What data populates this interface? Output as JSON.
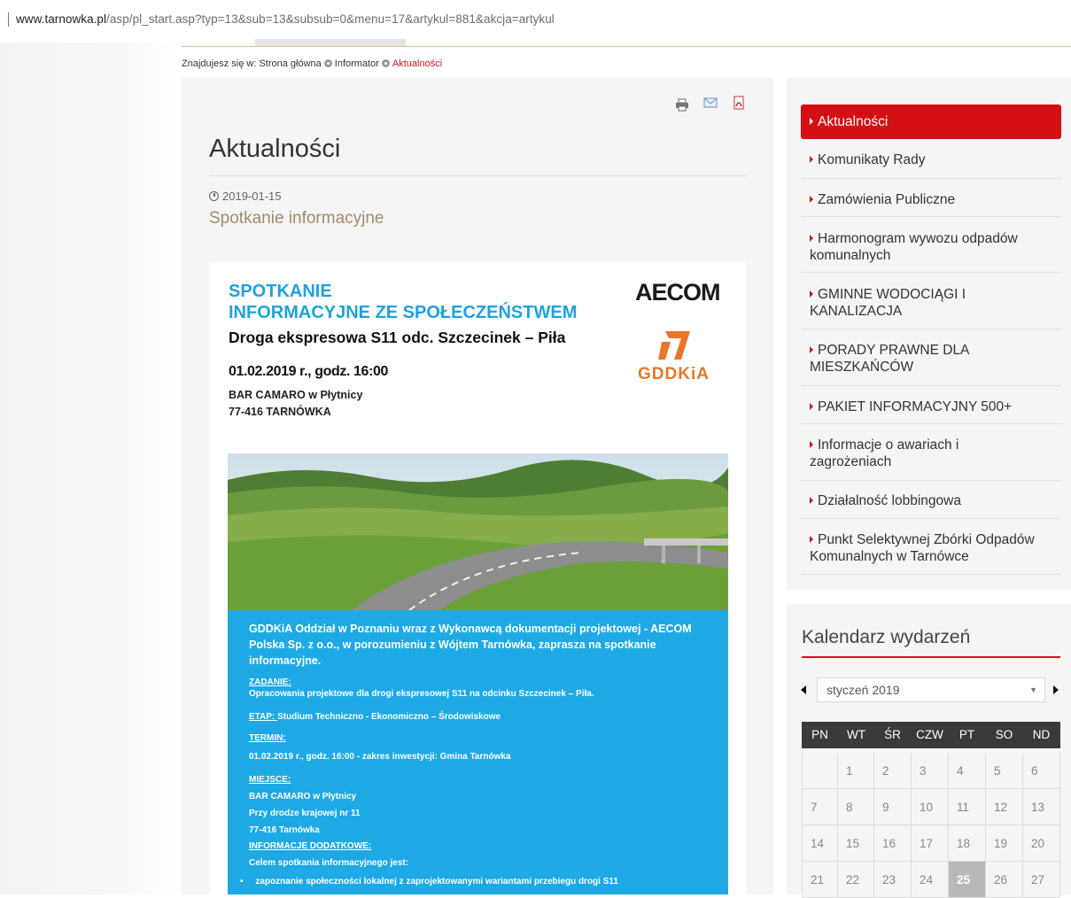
{
  "browser": {
    "url_host": "www.tarnowka.pl",
    "url_path": "/asp/pl_start.asp?typ=13&sub=13&subsub=0&menu=17&artykul=881&akcja=artykul"
  },
  "breadcrumb": {
    "prefix": "Znajdujesz się w:",
    "items": [
      "Strona główna",
      "Informator",
      "Aktualności"
    ]
  },
  "article": {
    "section_title": "Aktualności",
    "date": "2019-01-15",
    "title": "Spotkanie informacyjne",
    "tools": [
      "print-icon",
      "email-icon",
      "pdf-icon"
    ]
  },
  "poster": {
    "heading_line1": "SPOTKANIE",
    "heading_line2": "INFORMACYJNE ZE SPOŁECZEŃSTWEM",
    "road": "Droga ekspresowa S11 odc. Szczecinek – Piła",
    "datetime": "01.02.2019 r., godz. 16:00",
    "place": "BAR CAMARO w Płytnicy",
    "postal": "77-416 TARNÓWKA",
    "logo_aecom": "AECOM",
    "logo_gddkia": "GDDKiA",
    "intro": "GDDKiA Oddział w Poznaniu wraz z Wykonawcą dokumentacji projektowej - AECOM Polska Sp. z o.o., w porozumieniu z Wójtem Tarnówka, zaprasza na spotkanie informacyjne.",
    "zadanie_label": "ZADANIE:",
    "zadanie_text": "Opracowania projektowe dla drogi ekspresowej S11 na odcinku Szczecinek – Piła.",
    "etap_label": "ETAP:",
    "etap_text": "Studium Techniczno - Ekonomiczno – Środowiskowe",
    "termin_label": "TERMIN:",
    "termin_text": "01.02.2019 r., godz. 16:00 - zakres inwestycji: Gmina Tarnówka",
    "miejsce_label": "MIEJSCE:",
    "miejsce_line1": "BAR CAMARO w Płytnicy",
    "miejsce_line2": "Przy drodze krajowej nr 11",
    "miejsce_line3": "77-416 Tarnówka",
    "info_label": "INFORMACJE DODATKOWE:",
    "info_intro": "Celem spotkania informacyjnego jest:",
    "bullet1": "zapoznanie społeczności lokalnej z zaprojektowanymi wariantami przebiegu drogi S11"
  },
  "sidebar_menu": [
    {
      "label": "Aktualności",
      "active": true
    },
    {
      "label": "Komunikaty Rady"
    },
    {
      "label": "Zamówienia Publiczne"
    },
    {
      "label": "Harmonogram wywozu odpadów komunalnych"
    },
    {
      "label": "GMINNE WODOCIĄGI I KANALIZACJA"
    },
    {
      "label": "PORADY PRAWNE DLA MIESZKAŃCÓW"
    },
    {
      "label": "PAKIET INFORMACYJNY 500+"
    },
    {
      "label": "Informacje o awariach i zagrożeniach"
    },
    {
      "label": "Działalność lobbingowa"
    },
    {
      "label": "Punkt Selektywnej Zbórki Odpadów Komunalnych w Tarnówce"
    }
  ],
  "calendar": {
    "title": "Kalendarz wydarzeń",
    "month": "styczeń 2019",
    "weekdays": [
      "PN",
      "WT",
      "ŚR",
      "CZW",
      "PT",
      "SO",
      "ND"
    ],
    "days": [
      "",
      "1",
      "2",
      "3",
      "4",
      "5",
      "6",
      "7",
      "8",
      "9",
      "10",
      "11",
      "12",
      "13",
      "14",
      "15",
      "16",
      "17",
      "18",
      "19",
      "20",
      "21",
      "22",
      "23",
      "24",
      "25",
      "26",
      "27"
    ],
    "today": "25"
  }
}
